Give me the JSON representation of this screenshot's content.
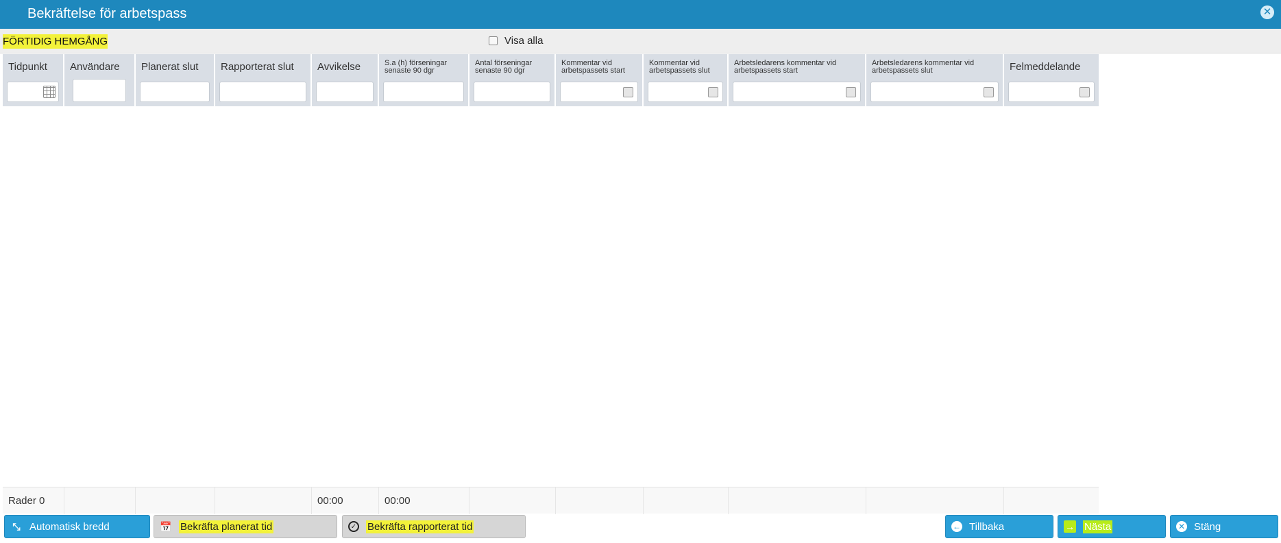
{
  "window": {
    "title": "Bekräftelse för arbetspass"
  },
  "toolbar": {
    "category": "FÖRTIDIG HEMGÅNG",
    "show_all_label": "Visa alla"
  },
  "grid": {
    "columns": [
      {
        "label": "Tidpunkt",
        "filter": "date"
      },
      {
        "label": "Användare",
        "filter": "text"
      },
      {
        "label": "Planerat slut",
        "filter": "text"
      },
      {
        "label": "Rapporterat slut",
        "filter": "text"
      },
      {
        "label": "Avvikelse",
        "filter": "text"
      },
      {
        "label": "S.a (h) förseningar senaste 90 dgr",
        "filter": "text"
      },
      {
        "label": "Antal förseningar senaste 90 dgr",
        "filter": "text"
      },
      {
        "label": "Kommentar vid arbetspassets start",
        "filter": "checkbox"
      },
      {
        "label": "Kommentar vid arbetspassets slut",
        "filter": "checkbox"
      },
      {
        "label": "Arbetsledarens kommentar vid arbetspassets start",
        "filter": "checkbox"
      },
      {
        "label": "Arbetsledarens kommentar vid arbetspassets slut",
        "filter": "checkbox"
      },
      {
        "label": "Felmeddelande",
        "filter": "checkbox"
      }
    ],
    "footer": {
      "rows_label": "Rader 0",
      "avvikelse_sum": "00:00",
      "delay_sum": "00:00"
    }
  },
  "buttons": {
    "auto_width": "Automatisk bredd",
    "confirm_planned": "Bekräfta planerat tid",
    "confirm_reported": "Bekräfta rapporterat tid",
    "back": "Tillbaka",
    "next": "Nästa",
    "close": "Stäng"
  },
  "colors": {
    "accent": "#1e88bd",
    "button_blue": "#2a9fd8",
    "highlight_yellow": "#f3f23a",
    "highlight_green": "#b8ec1a"
  }
}
